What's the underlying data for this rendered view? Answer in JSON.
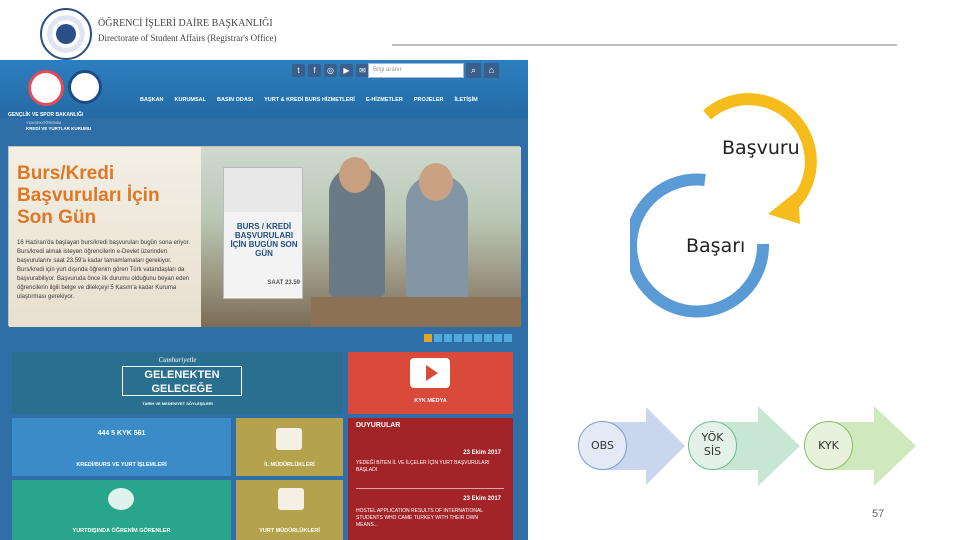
{
  "header": {
    "title": "ÖĞRENCİ İŞLERİ DAİRE BAŞKANLIĞI",
    "subtitle": "Directorate of Student Affairs (Registrar's Office)",
    "seal_icon": "university-seal-icon"
  },
  "website": {
    "org_line1": "GENÇLİK VE SPOR BAKANLIĞI",
    "org_line2": "YÜKSEKÖĞRENİM",
    "org_line3": "KREDİ VE YURTLAR KURUMU",
    "search_placeholder": "Bilgi aranır",
    "social_icons": [
      "twitter-icon",
      "facebook-icon",
      "instagram-icon",
      "youtube-icon",
      "email-icon"
    ],
    "nav": [
      "BAŞKAN",
      "KURUMSAL",
      "BASIN ODASI",
      "YURT & KREDİ BURS HİZMETLERİ",
      "E-HİZMETLER",
      "PROJELER",
      "İLETİŞİM"
    ],
    "hero": {
      "title": "Burs/Kredi Başvuruları İçin Son Gün",
      "text": "16 Haziran'da başlayan burs/kredi başvuruları bugün sona eriyor. Burs/kredi almak isteyen öğrencilerin e-Devlet üzerinden başvurularını saat 23.59'a kadar tamamlamaları gerekiyor. Burs/kredi için yurt dışında öğrenim gören Türk vatandaşları da başvurabiliyor. Başvuruda önce ilk durumu olduğunu beyan eden öğrencilerin ilgili belge ve dilekçeyi 5 Kasım'a kadar Kuruma ulaştırması gerekiyor.",
      "poster_text": "BURS / KREDİ BAŞVURULARI İÇİN BUGÜN SON GÜN",
      "poster_time": "SAAT 23.59"
    },
    "tiles": {
      "gelenek_script": "Cumhuriyetle",
      "gelenek_main": "GELENEKTEN GELECEĞE",
      "gelenek_sub": "TARİH VE MEDENİYET SÖYLEŞİLERİ",
      "kyk_media": "KYK MEDYA",
      "kredi": "KREDİ/BURS VE YURT İŞLEMLERİ",
      "kredi_phone": "444 5 KYK 561",
      "il": "İL MÜDÜRLÜKLERİ",
      "duyuru_head": "DUYURULAR",
      "duyuru_date1": "23 Ekim 2017",
      "duyuru_text1": "YEDEĞİ BİTEN İL VE İLÇELER İÇİN YURT BAŞVURULARI BAŞLADI",
      "duyuru_date2": "23 Ekim 2017",
      "duyuru_text2": "HOSTEL APPLICATION RESULTS OF INTERNATIONAL STUDENTS WHO CAME TURKEY WITH THEIR OWN MEANS...",
      "yurtdisi": "YURTDIŞINDA ÖĞRENİM GÖRENLER",
      "yurtmud": "YURT MÜDÜRLÜKLERİ"
    }
  },
  "cycle": {
    "top_label": "Başvuru",
    "bottom_label": "Başarı",
    "top_color": "#f5bc1c",
    "bottom_color": "#5b9bd5"
  },
  "process": {
    "steps": [
      {
        "label": "OBS"
      },
      {
        "label": "YÖK SİS"
      },
      {
        "label": "KYK"
      }
    ]
  },
  "page_number": "57"
}
